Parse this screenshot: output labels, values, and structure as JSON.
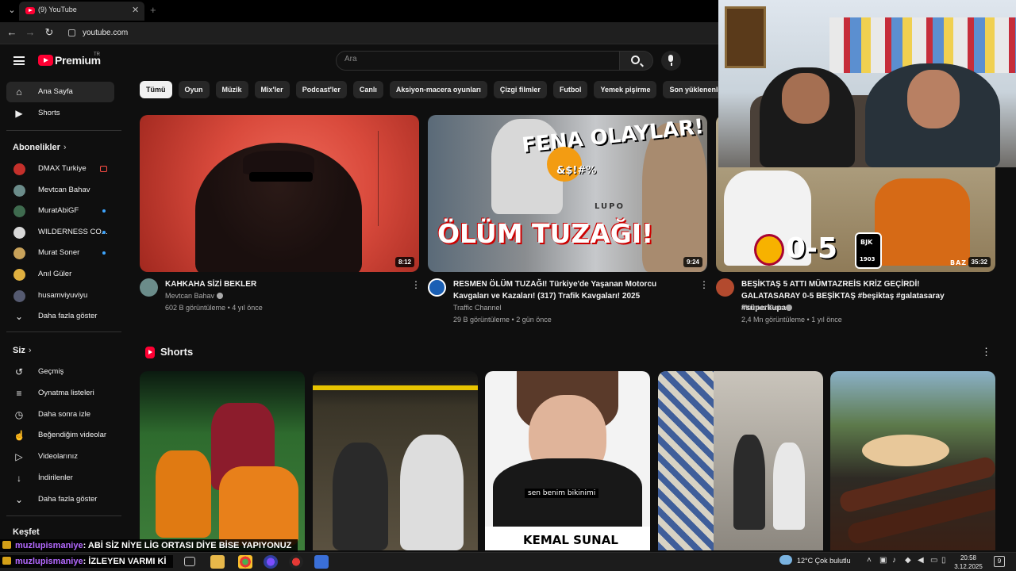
{
  "browser": {
    "tab_title": "(9) YouTube",
    "url": "youtube.com"
  },
  "header": {
    "logo_text": "Premium",
    "logo_region": "TR",
    "search_placeholder": "Ara"
  },
  "sidebar": {
    "main": [
      {
        "label": "Ana Sayfa",
        "icon": "home-icon",
        "active": true
      },
      {
        "label": "Shorts",
        "icon": "shorts-icon"
      }
    ],
    "subs_heading": "Abonelikler",
    "subscriptions": [
      {
        "label": "DMAX Turkiye",
        "indicator": "live",
        "color": "#c4302b"
      },
      {
        "label": "Mevtcan Bahav",
        "indicator": "none",
        "color": "#6b8c8a"
      },
      {
        "label": "MuratAbiGF",
        "indicator": "dot",
        "color": "#3f6b4f"
      },
      {
        "label": "WILDERNESS CO...",
        "indicator": "dot",
        "color": "#d8d8d8"
      },
      {
        "label": "Murat Soner",
        "indicator": "dot",
        "color": "#c8a25a"
      },
      {
        "label": "Anıl Güler",
        "indicator": "none",
        "color": "#e0b040"
      },
      {
        "label": "husamviyuviyu",
        "indicator": "none",
        "color": "#555a70"
      }
    ],
    "subs_more": "Daha fazla göster",
    "you_heading": "Siz",
    "you_items": [
      {
        "label": "Geçmiş",
        "icon": "history-icon"
      },
      {
        "label": "Oynatma listeleri",
        "icon": "playlist-icon"
      },
      {
        "label": "Daha sonra izle",
        "icon": "clock-icon"
      },
      {
        "label": "Beğendiğim videolar",
        "icon": "like-icon"
      },
      {
        "label": "Videolarınız",
        "icon": "video-icon"
      },
      {
        "label": "İndirilenler",
        "icon": "download-icon"
      },
      {
        "label": "Daha fazla göster",
        "icon": "chevron-down-icon"
      }
    ],
    "explore_heading": "Keşfet"
  },
  "chips": [
    "Tümü",
    "Oyun",
    "Müzik",
    "Mix'ler",
    "Podcast'ler",
    "Canlı",
    "Aksiyon-macera oyunları",
    "Çizgi filmler",
    "Futbol",
    "Yemek pişirme",
    "Son yüklenenler"
  ],
  "videos": [
    {
      "title": "KAHKAHA SİZİ BEKLER",
      "channel": "Mevtcan Bahav",
      "verified": true,
      "views": "602 B görüntüleme",
      "age": "4 yıl önce",
      "duration": "8:12"
    },
    {
      "title": "RESMEN ÖLÜM TUZAĞI! Türkiye'de Yaşanan Motorcu Kavgaları ve Kazaları! (317) Trafik Kavgaları! 2025",
      "channel": "Traffic Channel",
      "verified": false,
      "views": "29 B görüntüleme",
      "age": "2 gün önce",
      "duration": "9:24",
      "overlay_top": "FENA OLAYLAR!",
      "overlay_bottom": "ÖLÜM TUZAĞI!",
      "overlay_symbols": "&$!#%",
      "overlay_van": "LUPO"
    },
    {
      "title": "BEŞİKTAŞ 5 ATTI MÜMTAZREİS  KRİZ GEÇİRDİ! GALATASARAY 0-5 BEŞİKTAŞ #beşiktaş #galatasaray #süperkupa",
      "channel": "Mümtaz Reis",
      "verified": true,
      "views": "2,4 Mn görüntüleme",
      "age": "1 yıl önce",
      "duration": "35:32",
      "overlay_score": "0-5",
      "overlay_club": "BJK",
      "overlay_year": "1903",
      "overlay_corner": "BAZ"
    }
  ],
  "shorts": {
    "heading": "Shorts",
    "items": [
      {
        "caption": ""
      },
      {
        "caption": ""
      },
      {
        "caption": "sen benim bikinimi",
        "bottom_text": "KEMAL SUNAL"
      },
      {
        "caption": ""
      },
      {
        "caption": ""
      }
    ]
  },
  "chat": [
    {
      "user": "muzlupismaniye",
      "message": ": ABİ SİZ NİYE LİG ORTASI DİYE BİSE YAPIYONUZ"
    },
    {
      "user": "muzlupismaniye",
      "message": ": İZLEYEN VARMI Kİ"
    }
  ],
  "taskbar": {
    "weather": "12°C  Çok bulutlu",
    "time": "20:58",
    "date": "3.12.2025",
    "notifications": "9"
  }
}
